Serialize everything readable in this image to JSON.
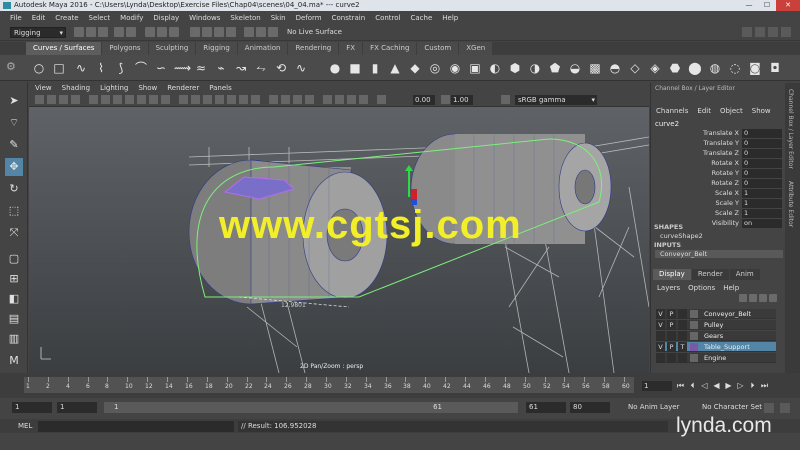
{
  "titlebar": {
    "title": "Autodesk Maya 2016 - C:\\Users\\Lynda\\Desktop\\Exercise Files\\Chap04\\scenes\\04_04.ma*   ---   curve2"
  },
  "menubar": [
    "File",
    "Edit",
    "Create",
    "Select",
    "Modify",
    "Display",
    "Windows",
    "Skeleton",
    "Skin",
    "Deform",
    "Constrain",
    "Control",
    "Cache",
    "Help"
  ],
  "statusline": {
    "mode": "Rigging",
    "live_surface": "No Live Surface"
  },
  "shelf": {
    "tabs": [
      "Curves / Surfaces",
      "Polygons",
      "Sculpting",
      "Rigging",
      "Animation",
      "Rendering",
      "FX",
      "FX Caching",
      "Custom",
      "XGen"
    ],
    "active_tab": "Curves / Surfaces"
  },
  "panel": {
    "menu": [
      "View",
      "Shading",
      "Lighting",
      "Show",
      "Renderer",
      "Panels"
    ],
    "exposure": "0.00",
    "gamma": "1.00",
    "color_space": "sRGB gamma",
    "viewport_label": "2D Pan/Zoom : persp",
    "measurement": "12.9801"
  },
  "watermark": "www.cgtsj.com",
  "channel_box": {
    "title": "Channel Box / Layer Editor",
    "menu": [
      "Channels",
      "Edit",
      "Object",
      "Show"
    ],
    "node": "curve2",
    "attributes": [
      {
        "name": "Translate X",
        "value": "0"
      },
      {
        "name": "Translate Y",
        "value": "0"
      },
      {
        "name": "Translate Z",
        "value": "0"
      },
      {
        "name": "Rotate X",
        "value": "0"
      },
      {
        "name": "Rotate Y",
        "value": "0"
      },
      {
        "name": "Rotate Z",
        "value": "0"
      },
      {
        "name": "Scale X",
        "value": "1"
      },
      {
        "name": "Scale Y",
        "value": "1"
      },
      {
        "name": "Scale Z",
        "value": "1"
      },
      {
        "name": "Visibility",
        "value": "on"
      }
    ],
    "shapes_label": "SHAPES",
    "shape": "curveShape2",
    "inputs_label": "INPUTS",
    "input": "Conveyor_Belt"
  },
  "layer_editor": {
    "tabs": [
      "Display",
      "Render",
      "Anim"
    ],
    "active_tab": "Display",
    "menu": [
      "Layers",
      "Options",
      "Help"
    ],
    "layers": [
      {
        "v": "V",
        "p": "P",
        "t": "",
        "name": "Conveyor_Belt",
        "color": "#2a2a2a"
      },
      {
        "v": "V",
        "p": "P",
        "t": "",
        "name": "Pulley",
        "color": "#2a2a2a"
      },
      {
        "v": "",
        "p": "",
        "t": "",
        "name": "Gears",
        "color": "#2a2a2a"
      },
      {
        "v": "V",
        "p": "P",
        "t": "T",
        "name": "Table_Support",
        "color": "#7a5aa8"
      },
      {
        "v": "",
        "p": "",
        "t": "",
        "name": "Engine",
        "color": "#2a2a2a"
      }
    ]
  },
  "side_tabs": [
    "Channel Box / Layer Editor",
    "Attribute Editor"
  ],
  "time_slider": {
    "ticks": [
      "1",
      "2",
      "4",
      "6",
      "8",
      "10",
      "12",
      "14",
      "16",
      "18",
      "20",
      "22",
      "24",
      "26",
      "28",
      "30",
      "32",
      "34",
      "36",
      "38",
      "40",
      "42",
      "44",
      "46",
      "48",
      "50",
      "52",
      "54",
      "56",
      "58",
      "60"
    ],
    "current_frame": "1"
  },
  "range_slider": {
    "start": "1",
    "playback_start": "1",
    "range_start": "1",
    "range_end": "61",
    "playback_end": "61",
    "end": "80",
    "anim_layer": "No Anim Layer",
    "character_set": "No Character Set"
  },
  "command_line": {
    "label": "MEL",
    "result": "// Result: 106.952028"
  },
  "brand": "lynda.com",
  "colors": {
    "accent": "#5285a6",
    "viewport_top": "#5f6367",
    "watermark": "#f2ef2a"
  },
  "icons": [
    "settings-icon",
    "select-tool-icon",
    "lasso-tool-icon",
    "paint-select-icon",
    "move-tool-icon",
    "rotate-tool-icon",
    "scale-tool-icon",
    "play-icon",
    "step-forward-icon",
    "rewind-icon"
  ]
}
